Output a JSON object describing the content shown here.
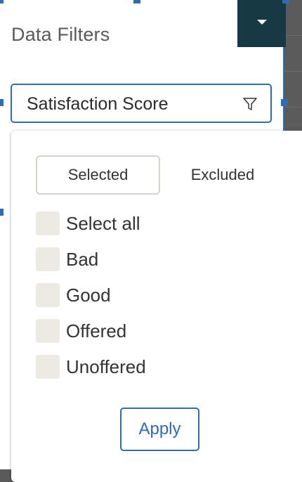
{
  "panel": {
    "title": "Data Filters",
    "corner_icon": "caret-down-icon"
  },
  "select": {
    "value": "Satisfaction Score",
    "icon": "filter-icon"
  },
  "dropdown": {
    "tabs": [
      {
        "label": "Selected",
        "active": true
      },
      {
        "label": "Excluded",
        "active": false
      }
    ],
    "options": [
      {
        "label": "Select all",
        "checked": false
      },
      {
        "label": "Bad",
        "checked": false
      },
      {
        "label": "Good",
        "checked": false
      },
      {
        "label": "Offered",
        "checked": false
      },
      {
        "label": "Unoffered",
        "checked": false
      }
    ],
    "apply_label": "Apply"
  },
  "colors": {
    "accent": "#2f6cb3",
    "corner_button": "#173943",
    "checkbox_fill": "#ede9e3",
    "tab_border": "#d6d3c8"
  }
}
